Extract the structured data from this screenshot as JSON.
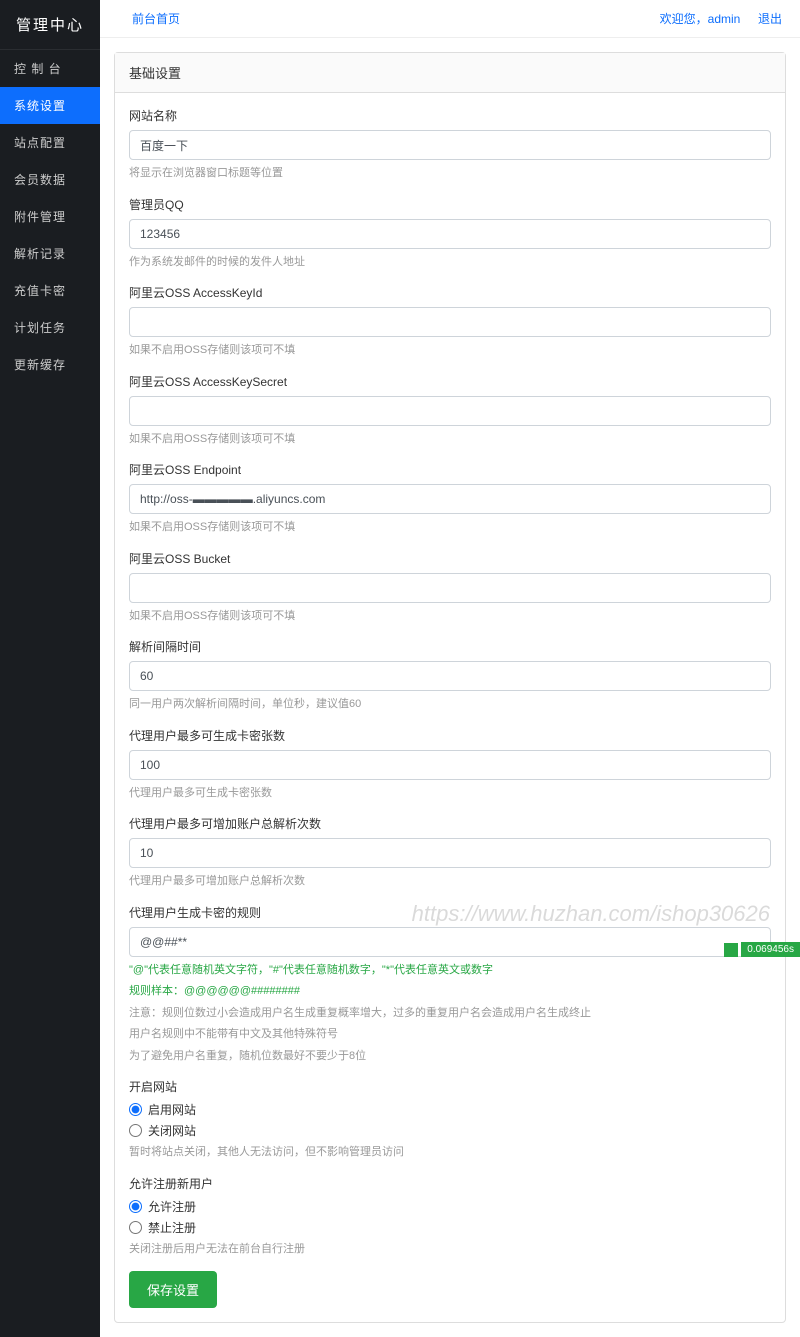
{
  "sidebar": {
    "title": "管理中心",
    "items": [
      {
        "label": "控 制 台"
      },
      {
        "label": "系统设置"
      },
      {
        "label": "站点配置"
      },
      {
        "label": "会员数据"
      },
      {
        "label": "附件管理"
      },
      {
        "label": "解析记录"
      },
      {
        "label": "充值卡密"
      },
      {
        "label": "计划任务"
      },
      {
        "label": "更新缓存"
      }
    ]
  },
  "topbar": {
    "home_link": "前台首页",
    "welcome": "欢迎您，",
    "username": "admin",
    "logout": "退出"
  },
  "panel": {
    "title": "基础设置"
  },
  "form": {
    "site_name": {
      "label": "网站名称",
      "value": "百度一下",
      "hint": "将显示在浏览器窗口标题等位置"
    },
    "admin_qq": {
      "label": "管理员QQ",
      "value": "123456",
      "hint": "作为系统发邮件的时候的发件人地址"
    },
    "oss_accesskey": {
      "label": "阿里云OSS AccessKeyId",
      "value": "",
      "hint": "如果不启用OSS存储则该项可不填"
    },
    "oss_secret": {
      "label": "阿里云OSS AccessKeySecret",
      "value": "",
      "hint": "如果不启用OSS存储则该项可不填"
    },
    "oss_endpoint": {
      "label": "阿里云OSS Endpoint",
      "value": "http://oss-▬▬▬▬▬.aliyuncs.com",
      "hint": "如果不启用OSS存储则该项可不填"
    },
    "oss_bucket": {
      "label": "阿里云OSS Bucket",
      "value": "",
      "hint": "如果不启用OSS存储则该项可不填"
    },
    "parse_interval": {
      "label": "解析间隔时间",
      "value": "60",
      "hint": "同一用户两次解析间隔时间，单位秒，建议值60"
    },
    "agent_max_cards": {
      "label": "代理用户最多可生成卡密张数",
      "value": "100",
      "hint": "代理用户最多可生成卡密张数"
    },
    "agent_max_parse": {
      "label": "代理用户最多可增加账户总解析次数",
      "value": "10",
      "hint": "代理用户最多可增加账户总解析次数"
    },
    "card_rule": {
      "label": "代理用户生成卡密的规则",
      "value": "@@##**",
      "hint1": "\"@\"代表任意随机英文字符，\"#\"代表任意随机数字，\"*\"代表任意英文或数字",
      "hint2": "规则样本：@@@@@@########",
      "hint3": "注意：规则位数过小会造成用户名生成重复概率增大，过多的重复用户名会造成用户名生成终止",
      "hint4": "用户名规则中不能带有中文及其他特殊符号",
      "hint5": "为了避免用户名重复，随机位数最好不要少于8位"
    },
    "site_open": {
      "label": "开启网站",
      "opt1": "启用网站",
      "opt2": "关闭网站",
      "hint": "暂时将站点关闭，其他人无法访问，但不影响管理员访问"
    },
    "allow_register": {
      "label": "允许注册新用户",
      "opt1": "允许注册",
      "opt2": "禁止注册",
      "hint": "关闭注册后用户无法在前台自行注册"
    },
    "save_btn": "保存设置"
  },
  "watermark": "https://www.huzhan.com/ishop30626",
  "timer": "0.069456s"
}
